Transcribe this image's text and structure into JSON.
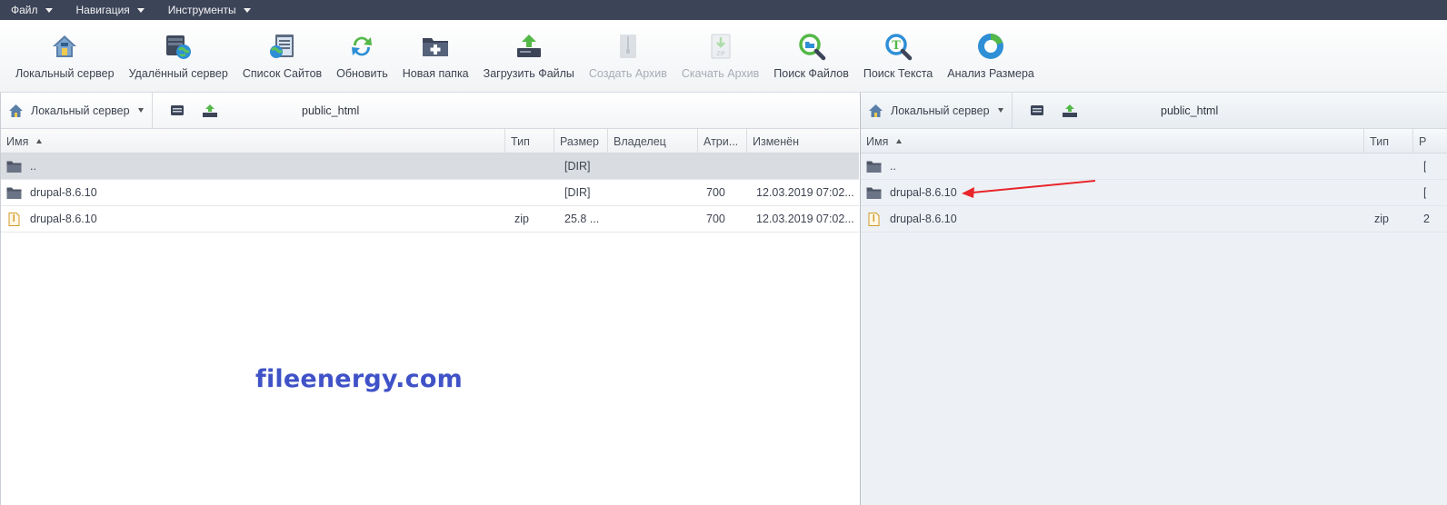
{
  "menubar": {
    "items": [
      {
        "label": "Файл"
      },
      {
        "label": "Навигация"
      },
      {
        "label": "Инструменты"
      }
    ]
  },
  "toolbar": {
    "buttons": [
      {
        "label": "Локальный сервер",
        "icon": "home-server-icon",
        "enabled": true
      },
      {
        "label": "Удалённый сервер",
        "icon": "remote-server-icon",
        "enabled": true
      },
      {
        "label": "Список Сайтов",
        "icon": "site-list-icon",
        "enabled": true
      },
      {
        "label": "Обновить",
        "icon": "refresh-icon",
        "enabled": true
      },
      {
        "label": "Новая папка",
        "icon": "new-folder-icon",
        "enabled": true
      },
      {
        "label": "Загрузить Файлы",
        "icon": "upload-icon",
        "enabled": true
      },
      {
        "label": "Создать Архив",
        "icon": "archive-icon",
        "enabled": false
      },
      {
        "label": "Скачать Архив",
        "icon": "download-archive-icon",
        "enabled": false
      },
      {
        "label": "Поиск Файлов",
        "icon": "search-files-icon",
        "enabled": true
      },
      {
        "label": "Поиск Текста",
        "icon": "search-text-icon",
        "enabled": true
      },
      {
        "label": "Анализ Размера",
        "icon": "size-analysis-icon",
        "enabled": true
      }
    ]
  },
  "left": {
    "server": "Локальный сервер",
    "path": "public_html",
    "columns": [
      "Имя",
      "Тип",
      "Размер",
      "Владелец",
      "Атри...",
      "Изменён"
    ],
    "rows": [
      {
        "name": "..",
        "type": "",
        "size": "[DIR]",
        "owner": "",
        "attr": "",
        "modified": ""
      },
      {
        "name": "drupal-8.6.10",
        "type": "",
        "size": "[DIR]",
        "owner": "",
        "attr": "700",
        "modified": "12.03.2019 07:02..."
      },
      {
        "name": "drupal-8.6.10",
        "type": "zip",
        "size": "25.8 ...",
        "owner": "",
        "attr": "700",
        "modified": "12.03.2019 07:02..."
      }
    ]
  },
  "right": {
    "server": "Локальный сервер",
    "path": "public_html",
    "columns": [
      "Имя",
      "Тип",
      "Р"
    ],
    "rows": [
      {
        "name": "..",
        "type": "",
        "size": "["
      },
      {
        "name": "drupal-8.6.10",
        "type": "",
        "size": "["
      },
      {
        "name": "drupal-8.6.10",
        "type": "zip",
        "size": "2"
      }
    ]
  },
  "watermark": "fileenergy.com",
  "colors": {
    "menubar": "#3c4458",
    "arrow": "#e8262a",
    "watermark": "#3f52c7"
  }
}
